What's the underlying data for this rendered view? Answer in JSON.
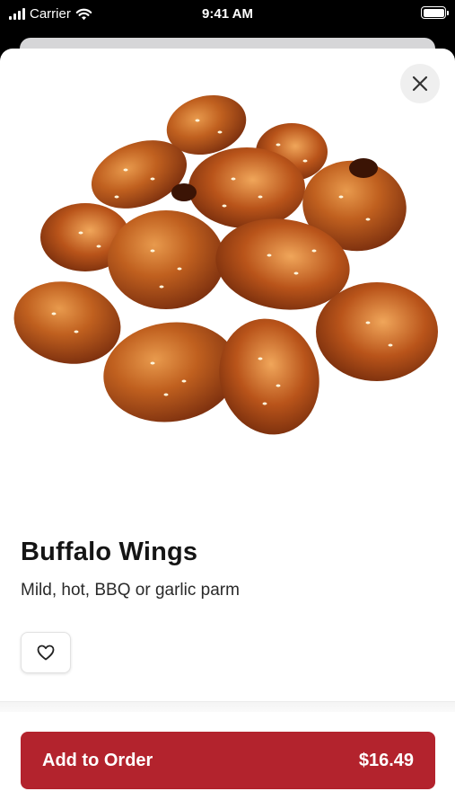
{
  "status_bar": {
    "carrier": "Carrier",
    "time": "9:41 AM",
    "icons": [
      "signal-icon",
      "wifi-icon",
      "battery-icon"
    ]
  },
  "item": {
    "image": "buffalo-wings-photo",
    "name": "Buffalo Wings",
    "description": "Mild, hot, BBQ or garlic parm"
  },
  "actions": {
    "close_icon": "close-icon",
    "favorite_icon": "heart-icon",
    "add_to_order_label": "Add to Order",
    "price": "$16.49"
  },
  "colors": {
    "primary": "#b3232d",
    "background": "#ffffff",
    "status_bar": "#000000"
  }
}
